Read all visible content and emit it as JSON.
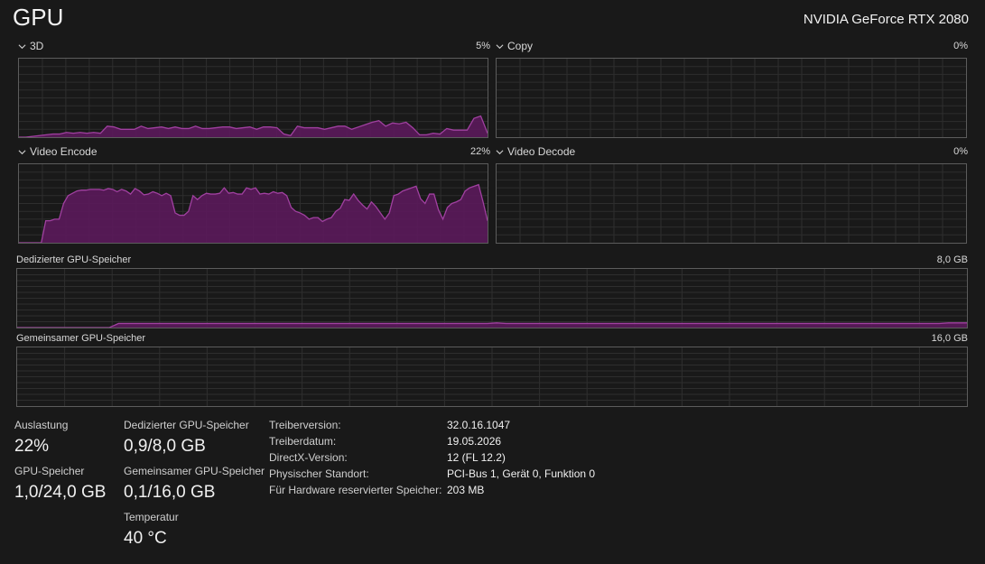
{
  "title": "GPU",
  "gpu_name": "NVIDIA GeForce RTX 2080",
  "colors": {
    "accent": "#a040a0",
    "fill": "#5b1a5b",
    "grid": "#2e2e2e",
    "border": "#5c5c5c"
  },
  "graphs": {
    "g3d": {
      "label": "3D",
      "percent": "5%",
      "values": [
        0,
        0,
        1,
        2,
        3,
        4,
        4,
        6,
        5,
        6,
        5,
        6,
        5,
        14,
        13,
        10,
        10,
        10,
        14,
        11,
        12,
        13,
        11,
        13,
        11,
        11,
        14,
        11,
        11,
        12,
        13,
        13,
        11,
        12,
        13,
        10,
        13,
        13,
        12,
        4,
        2,
        14,
        12,
        12,
        12,
        10,
        12,
        14,
        14,
        10,
        13,
        16,
        19,
        21,
        14,
        18,
        17,
        19,
        12,
        3,
        3,
        5,
        4,
        11,
        9,
        9,
        9,
        24,
        27,
        5
      ]
    },
    "copy": {
      "label": "Copy",
      "percent": "0%",
      "values": []
    },
    "encode": {
      "label": "Video Encode",
      "percent": "22%",
      "values": [
        0,
        0,
        0,
        0,
        0,
        0,
        28,
        28,
        30,
        30,
        50,
        60,
        63,
        66,
        67,
        67,
        68,
        68,
        68,
        67,
        69,
        68,
        65,
        68,
        66,
        62,
        69,
        66,
        61,
        62,
        65,
        63,
        60,
        63,
        60,
        38,
        35,
        35,
        40,
        60,
        55,
        60,
        63,
        62,
        62,
        63,
        70,
        63,
        64,
        62,
        62,
        70,
        68,
        70,
        62,
        63,
        62,
        65,
        63,
        64,
        60,
        45,
        40,
        38,
        35,
        30,
        32,
        32,
        27,
        30,
        32,
        40,
        44,
        55,
        54,
        62,
        54,
        48,
        43,
        52,
        46,
        38,
        30,
        38,
        60,
        62,
        66,
        68,
        70,
        72,
        56,
        50,
        62,
        62,
        42,
        30,
        45,
        50,
        52,
        55,
        66,
        70,
        72,
        74,
        52,
        28
      ]
    },
    "decode": {
      "label": "Video Decode",
      "percent": "0%",
      "values": []
    }
  },
  "memory": {
    "dedicated": {
      "label": "Dedizierter GPU-Speicher",
      "max": "8,0 GB",
      "values": [
        0,
        0,
        0,
        0,
        0,
        0,
        0,
        0,
        0,
        0,
        0,
        7,
        7,
        7,
        7,
        7,
        7,
        7,
        7,
        7,
        7,
        7,
        7,
        7,
        7,
        7,
        7,
        7,
        7,
        7,
        7,
        7,
        7,
        7,
        7,
        7,
        7,
        7,
        7,
        7,
        7,
        7,
        7,
        7,
        7,
        7,
        7,
        7,
        7,
        7,
        7,
        7,
        8,
        7,
        7,
        7,
        7,
        7,
        7,
        7,
        7,
        7,
        7,
        7,
        7,
        7,
        7,
        7,
        7,
        7,
        7,
        7,
        7,
        7,
        7,
        7,
        7,
        7,
        7,
        7,
        7,
        7,
        7,
        7,
        7,
        7,
        7,
        7,
        7,
        7,
        7,
        7,
        7,
        7,
        7,
        7,
        7,
        7,
        7,
        7,
        7,
        8,
        8,
        8
      ]
    },
    "shared": {
      "label": "Gemeinsamer GPU-Speicher",
      "max": "16,0 GB",
      "values": []
    }
  },
  "stats": {
    "auslastung": {
      "label": "Auslastung",
      "value": "22%"
    },
    "gpu_speicher": {
      "label": "GPU-Speicher",
      "value": "1,0/24,0 GB"
    },
    "dedicated": {
      "label": "Dedizierter GPU-Speicher",
      "value": "0,9/8,0 GB"
    },
    "shared": {
      "label": "Gemeinsamer GPU-Speicher",
      "value": "0,1/16,0 GB"
    },
    "temp": {
      "label": "Temperatur",
      "value": "40 °C"
    }
  },
  "info": [
    {
      "label": "Treiberversion:",
      "value": "32.0.16.1047"
    },
    {
      "label": "Treiberdatum:",
      "value": "19.05.2026"
    },
    {
      "label": "DirectX-Version:",
      "value": "12 (FL 12.2)"
    },
    {
      "label": "Physischer Standort:",
      "value": "PCI-Bus 1, Gerät 0, Funktion 0"
    },
    {
      "label": "Für Hardware reservierter Speicher:",
      "value": "203 MB"
    }
  ]
}
